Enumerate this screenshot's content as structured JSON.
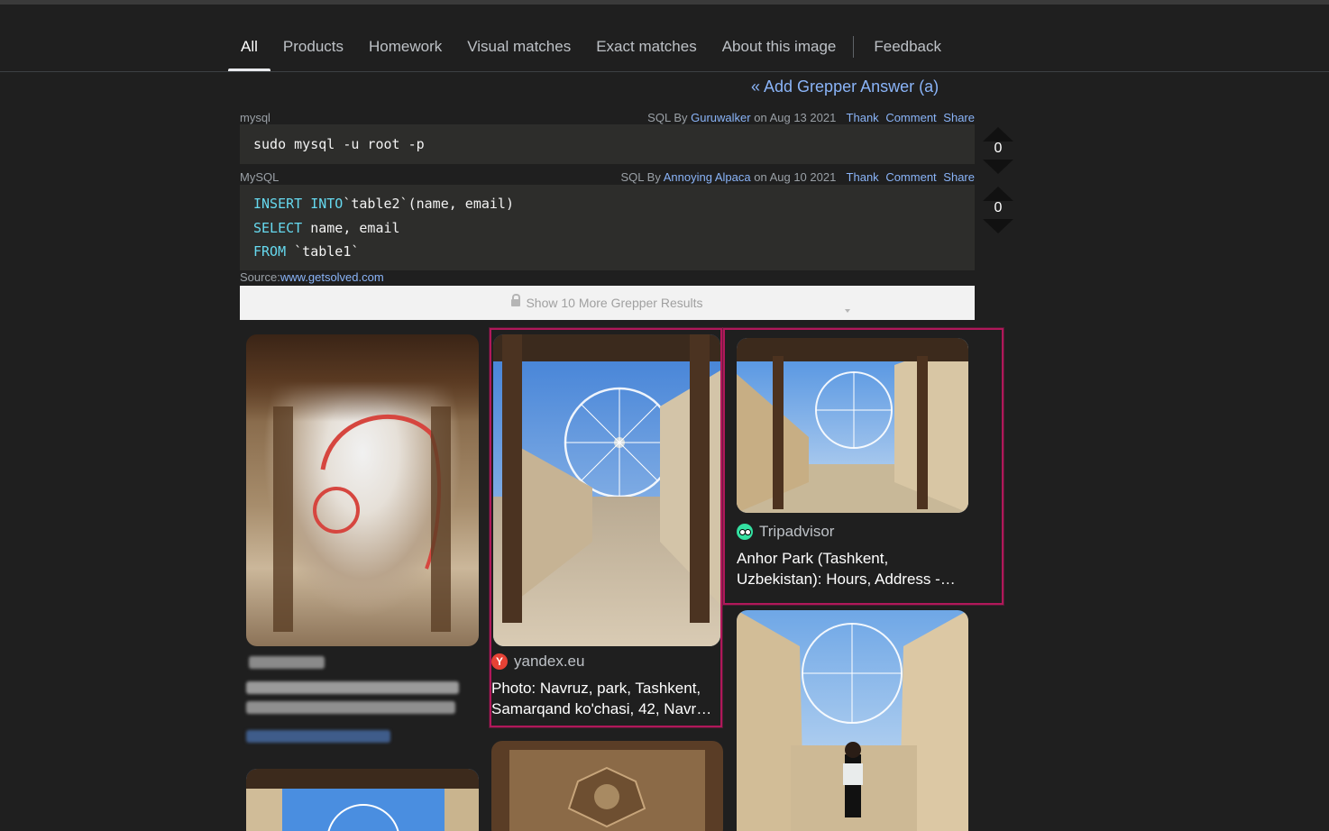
{
  "tabs": [
    {
      "label": "All",
      "active": true
    },
    {
      "label": "Products"
    },
    {
      "label": "Homework"
    },
    {
      "label": "Visual matches"
    },
    {
      "label": "Exact matches"
    },
    {
      "label": "About this image"
    },
    {
      "label": "Feedback"
    }
  ],
  "grepper": {
    "add_answer": "« Add Grepper Answer (a)",
    "snippets": [
      {
        "lang": "mysql",
        "type": "SQL",
        "by": "By",
        "author": "Guruwalker",
        "date": "on Aug 13 2021",
        "actions": [
          "Thank",
          "Comment",
          "Share"
        ],
        "code": [
          "sudo mysql -u root -p"
        ],
        "votes": "0"
      },
      {
        "lang": "MySQL",
        "type": "SQL",
        "by": "By",
        "author": "Annoying Alpaca",
        "date": "on Aug 10 2021",
        "actions": [
          "Thank",
          "Comment",
          "Share"
        ],
        "code": [
          {
            "kw": "INSERT INTO",
            "rest": "`table2`(name, email)"
          },
          {
            "kw": "SELECT",
            "rest": " name, email"
          },
          {
            "kw": "FROM",
            "rest": " `table1`"
          }
        ],
        "votes": "0"
      }
    ],
    "source_label": "Source:",
    "source_link": "www.getsolved.com",
    "show_more": "Show 10 More Grepper Results"
  },
  "results": [
    {
      "source": "yandex.eu",
      "favicon": "yandex",
      "favicon_letter": "Y",
      "caption": [
        "Photo: Navruz, park, Tashkent,",
        "Samarqand ko'chasi, 42, Navr…"
      ]
    },
    {
      "source": "Tripadvisor",
      "favicon": "tripadvisor",
      "caption": [
        "Anhor Park (Tashkent,",
        "Uzbekistan): Hours, Address -…"
      ]
    }
  ],
  "colors": {
    "background": "#1f1f1f",
    "link": "#8ab4f8",
    "highlight_border": "#b0185a",
    "code_bg": "#2d2d2b",
    "keyword": "#66d9ef"
  }
}
